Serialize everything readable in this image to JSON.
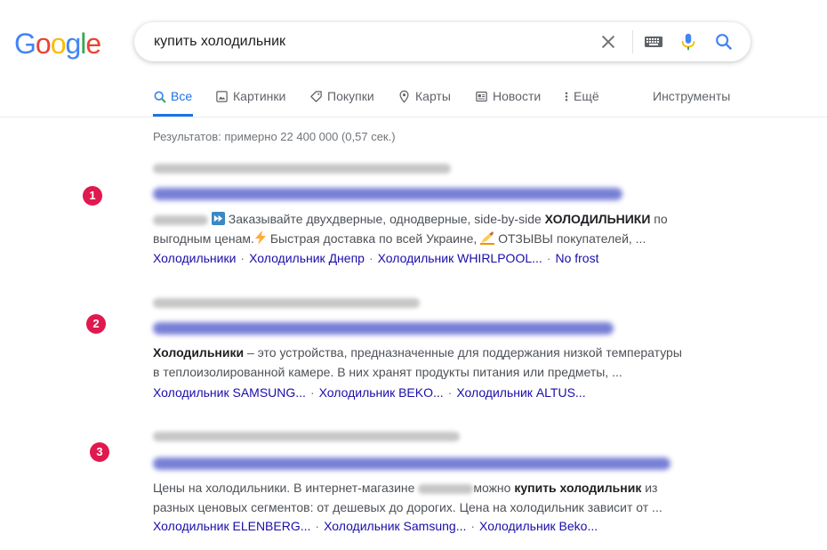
{
  "logo": {
    "letters": [
      "G",
      "o",
      "o",
      "g",
      "l",
      "e"
    ],
    "colors": [
      "#4285F4",
      "#EA4335",
      "#FBBC05",
      "#4285F4",
      "#34A853",
      "#EA4335"
    ]
  },
  "search": {
    "query": "купить холодильник"
  },
  "tabs": [
    {
      "label": "Все",
      "icon": "search-icon"
    },
    {
      "label": "Картинки",
      "icon": "image-icon"
    },
    {
      "label": "Покупки",
      "icon": "tag-icon"
    },
    {
      "label": "Карты",
      "icon": "map-pin-icon"
    },
    {
      "label": "Новости",
      "icon": "news-icon"
    },
    {
      "label": "Ещё",
      "icon": "more-vert-icon"
    }
  ],
  "tools_label": "Инструменты",
  "stats": "Результатов: примерно 22 400 000 (0,57 сек.)",
  "results": [
    {
      "badge": "1",
      "snippet_parts": [
        "Заказывайте двухдверные, однодверные, side-by-side ",
        "ХОЛОДИЛЬНИКИ",
        " по выгодным ценам.",
        " Быстрая доставка по всей Украине, ",
        " ОТЗЫВЫ покупателей, ..."
      ],
      "sitelinks": [
        "Холодильники",
        "Холодильник Днепр",
        "Холодильник WHIRLPOOL...",
        "No frost"
      ]
    },
    {
      "badge": "2",
      "snippet_parts": [
        "Холодильники",
        " – это устройства, предназначенные для поддержания низкой температуры в теплоизолированной камере. В них хранят продукты питания или предметы, ..."
      ],
      "sitelinks": [
        "Холодильник SAMSUNG...",
        "Холодильник BEKO...",
        "Холодильник ALTUS..."
      ]
    },
    {
      "badge": "3",
      "snippet_parts": [
        "Цены на холодильники. В интернет-магазине ",
        "можно ",
        "купить холодильник",
        " из разных ценовых сегментов: от дешевых до дорогих. Цена на холодильник зависит от ..."
      ],
      "sitelinks": [
        "Холодильник ELENBERG...",
        "Холодильник Samsung...",
        "Холодильник Beko..."
      ]
    }
  ]
}
